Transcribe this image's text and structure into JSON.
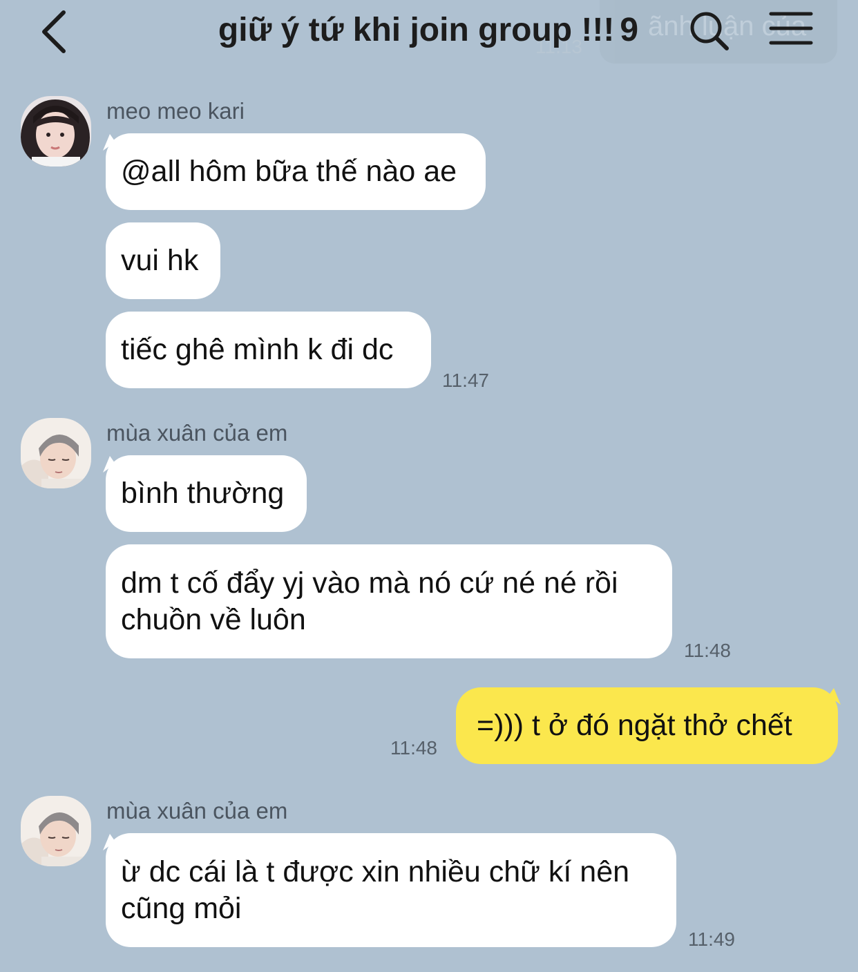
{
  "header": {
    "title": "giữ ý tứ khi join group !!!",
    "member_count": "9",
    "back_icon": "chevron-left-icon",
    "search_icon": "search-icon",
    "menu_icon": "menu-icon",
    "faded_preview_text": "ãnh luận của",
    "faded_preview_time": "11:13"
  },
  "colors": {
    "background": "#afc1d1",
    "bubble_other": "#ffffff",
    "bubble_mine": "#fbe74d"
  },
  "messages": {
    "group1": {
      "sender": "meo meo kari",
      "m1": "@all hôm bữa thế nào ae",
      "m2": "vui hk",
      "m3": "tiếc ghê mình k đi dc",
      "time": "11:47"
    },
    "group2": {
      "sender": "mùa xuân của em",
      "m1": "bình thường",
      "m2_line1": "dm t cố đẩy yj vào mà nó cứ né né rồi",
      "m2_line2": "chuồn về luôn",
      "time": "11:48"
    },
    "mine": {
      "text": "=))) t ở đó ngặt thở chết",
      "time": "11:48"
    },
    "group3": {
      "sender": "mùa xuân của em",
      "m1_line1": "ừ dc cái là t được xin nhiều chữ kí nên",
      "m1_line2": "cũng mỏi",
      "time": "11:49"
    }
  }
}
